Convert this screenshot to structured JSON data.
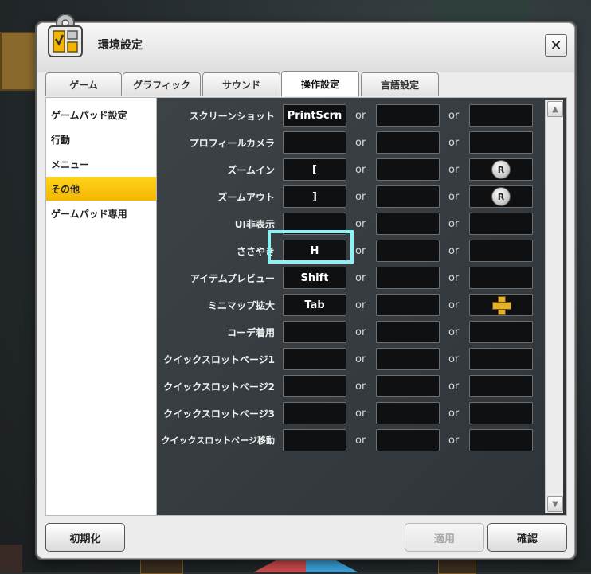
{
  "window": {
    "title": "環境設定",
    "close_glyph": "✕"
  },
  "tabs": [
    {
      "label": "ゲーム",
      "active": false
    },
    {
      "label": "グラフィック",
      "active": false
    },
    {
      "label": "サウンド",
      "active": false
    },
    {
      "label": "操作設定",
      "active": true
    },
    {
      "label": "言語設定",
      "active": false
    }
  ],
  "sidebar": {
    "items": [
      {
        "label": "ゲームパッド設定",
        "active": false
      },
      {
        "label": "行動",
        "active": false
      },
      {
        "label": "メニュー",
        "active": false
      },
      {
        "label": "その他",
        "active": true
      },
      {
        "label": "ゲームパッド専用",
        "active": false
      }
    ]
  },
  "bindings": {
    "or_label": "or",
    "rows": [
      {
        "label": "スクリーンショット",
        "key1": "PrintScrn",
        "key2": "",
        "key3": "",
        "icon3": ""
      },
      {
        "label": "プロフィールカメラ",
        "key1": "",
        "key2": "",
        "key3": "",
        "icon3": ""
      },
      {
        "label": "ズームイン",
        "key1": "[",
        "key2": "",
        "key3": "R",
        "icon3": "r-stick-up-icon"
      },
      {
        "label": "ズームアウト",
        "key1": "]",
        "key2": "",
        "key3": "R",
        "icon3": "r-stick-down-icon"
      },
      {
        "label": "UI非表示",
        "key1": "",
        "key2": "",
        "key3": "",
        "icon3": ""
      },
      {
        "label": "ささやき",
        "key1": "H",
        "key2": "",
        "key3": "",
        "icon3": ""
      },
      {
        "label": "アイテムプレビュー",
        "key1": "Shift",
        "key2": "",
        "key3": "",
        "icon3": ""
      },
      {
        "label": "ミニマップ拡大",
        "key1": "Tab",
        "key2": "",
        "key3": "",
        "icon3": "dpad-icon"
      },
      {
        "label": "コーデ着用",
        "key1": "",
        "key2": "",
        "key3": "",
        "icon3": ""
      },
      {
        "label": "クイックスロットページ1",
        "key1": "",
        "key2": "",
        "key3": "",
        "icon3": ""
      },
      {
        "label": "クイックスロットページ2",
        "key1": "",
        "key2": "",
        "key3": "",
        "icon3": ""
      },
      {
        "label": "クイックスロットページ3",
        "key1": "",
        "key2": "",
        "key3": "",
        "icon3": ""
      },
      {
        "label": "クイックスロットページ移動",
        "key1": "",
        "key2": "",
        "key3": "",
        "icon3": ""
      }
    ]
  },
  "scrollbar": {
    "up_glyph": "▲",
    "down_glyph": "▼"
  },
  "buttons": {
    "reset": "初期化",
    "apply": "適用",
    "confirm": "確認"
  },
  "colors": {
    "active_tab_accent": "#f3b800",
    "focus_highlight": "#8df2f6"
  }
}
